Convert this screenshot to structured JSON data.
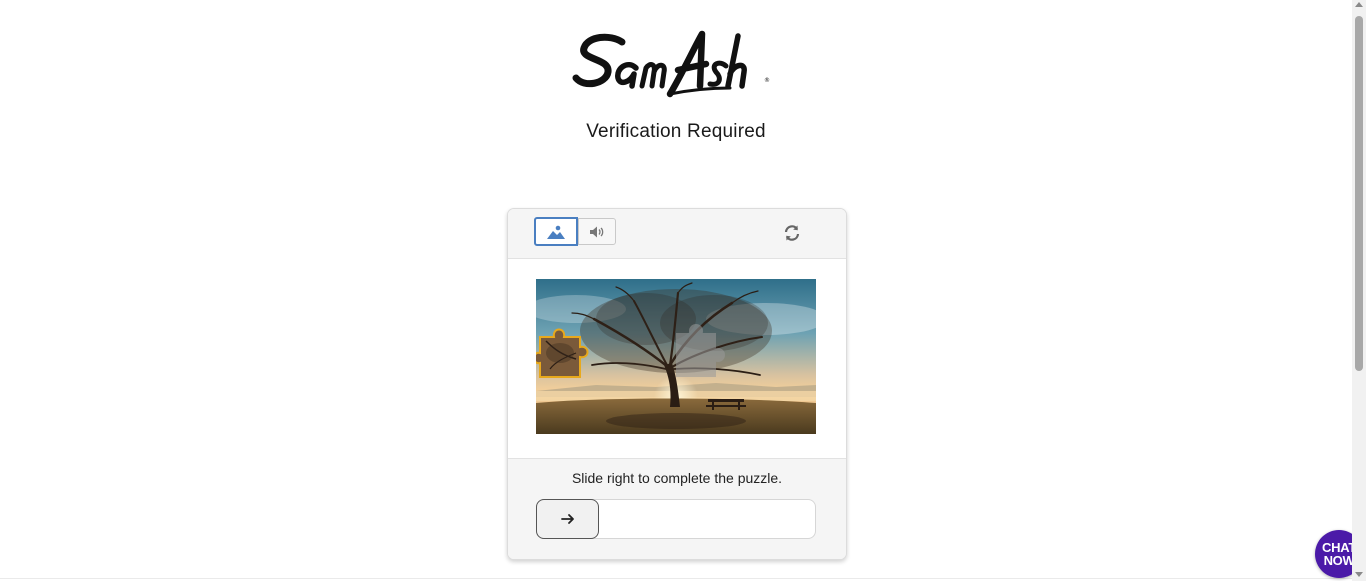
{
  "brand": {
    "logo_text": "SamAsh",
    "logo_mark": "®"
  },
  "heading": {
    "title": "Verification Required"
  },
  "captcha": {
    "modes": [
      {
        "name": "image",
        "icon": "image-icon",
        "active": true
      },
      {
        "name": "audio",
        "icon": "speaker-icon",
        "active": false
      }
    ],
    "refresh_icon": "refresh-icon",
    "instruction": "Slide right to complete the puzzle.",
    "slider": {
      "handle_icon": "arrow-right-icon",
      "progress": 0
    }
  },
  "chat": {
    "line1": "CHAT",
    "line2": "NOW",
    "color": "#4b1aa8"
  },
  "colors": {
    "accent": "#4a7fc1",
    "chat": "#4b1aa8"
  }
}
